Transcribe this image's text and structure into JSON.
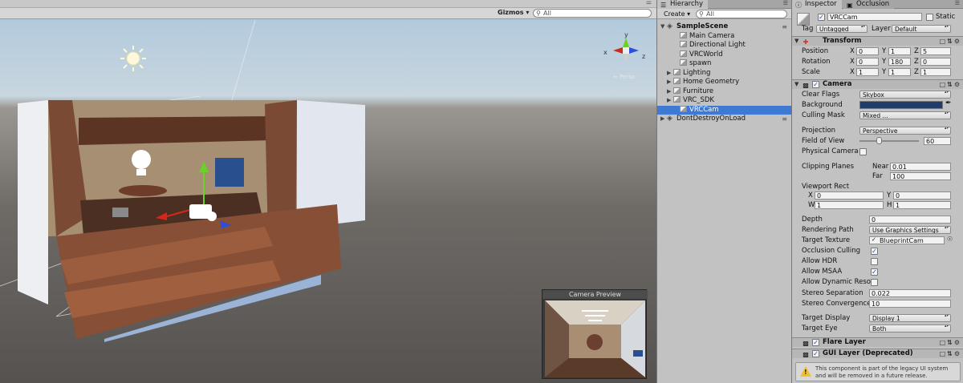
{
  "scene": {
    "gizmos_label": "Gizmos",
    "search_placeholder": "All",
    "persp_label": "← Persp",
    "preview_title": "Camera Preview",
    "axis_labels": {
      "y": "y",
      "x": "x",
      "z": "z"
    }
  },
  "hierarchy": {
    "tab": "Hierarchy",
    "create_label": "Create ▾",
    "search_placeholder": "All",
    "rows": [
      {
        "label": "SampleScene",
        "indent": 0,
        "arrow": "▼",
        "icon": "unity-scene-icon",
        "bold": true,
        "menu": true
      },
      {
        "label": "Main Camera",
        "indent": 2,
        "arrow": "",
        "icon": "gameobject-icon"
      },
      {
        "label": "Directional Light",
        "indent": 2,
        "arrow": "",
        "icon": "gameobject-icon"
      },
      {
        "label": "VRCWorld",
        "indent": 2,
        "arrow": "",
        "icon": "gameobject-icon"
      },
      {
        "label": "spawn",
        "indent": 2,
        "arrow": "",
        "icon": "gameobject-icon"
      },
      {
        "label": "Lighting",
        "indent": 1,
        "arrow": "▶",
        "icon": "gameobject-icon"
      },
      {
        "label": "Home Geometry",
        "indent": 1,
        "arrow": "▶",
        "icon": "gameobject-icon"
      },
      {
        "label": "Furniture",
        "indent": 1,
        "arrow": "▶",
        "icon": "gameobject-icon"
      },
      {
        "label": "VRC_SDK",
        "indent": 1,
        "arrow": "▶",
        "icon": "gameobject-icon"
      },
      {
        "label": "VRCCam",
        "indent": 2,
        "arrow": "",
        "icon": "gameobject-icon",
        "selected": true
      },
      {
        "label": "DontDestroyOnLoad",
        "indent": 0,
        "arrow": "▶",
        "icon": "unity-scene-icon",
        "menu": true
      }
    ]
  },
  "inspector": {
    "tabs": {
      "inspector": "Inspector",
      "occlusion": "Occlusion"
    },
    "object_name": "VRCCam",
    "static_label": "Static",
    "tag_label": "Tag",
    "tag_value": "Untagged",
    "layer_label": "Layer",
    "layer_value": "Default",
    "transform": {
      "title": "Transform",
      "position_label": "Position",
      "rotation_label": "Rotation",
      "scale_label": "Scale",
      "position": {
        "x": "0",
        "y": "1",
        "z": "5"
      },
      "rotation": {
        "x": "0",
        "y": "180",
        "z": "0"
      },
      "scale": {
        "x": "1",
        "y": "1",
        "z": "1"
      },
      "axis": {
        "x": "X",
        "y": "Y",
        "z": "Z"
      }
    },
    "camera": {
      "title": "Camera",
      "clear_flags_label": "Clear Flags",
      "clear_flags": "Skybox",
      "background_label": "Background",
      "background_color": "#1f3c6a",
      "culling_mask_label": "Culling Mask",
      "culling_mask": "Mixed ...",
      "projection_label": "Projection",
      "projection": "Perspective",
      "fov_label": "Field of View",
      "fov": "60",
      "fov_fraction": 0.33,
      "physical_label": "Physical Camera",
      "clipping_label": "Clipping Planes",
      "near_label": "Near",
      "near": "0.01",
      "far_label": "Far",
      "far": "100",
      "viewport_label": "Viewport Rect",
      "vp": {
        "x_label": "X",
        "x": "0",
        "y_label": "Y",
        "y": "0",
        "w_label": "W",
        "w": "1",
        "h_label": "H",
        "h": "1"
      },
      "depth_label": "Depth",
      "depth": "0",
      "rendering_path_label": "Rendering Path",
      "rendering_path": "Use Graphics Settings",
      "target_texture_label": "Target Texture",
      "target_texture": "BlueprintCam",
      "occlusion_label": "Occlusion Culling",
      "hdr_label": "Allow HDR",
      "msaa_label": "Allow MSAA",
      "dynres_label": "Allow Dynamic Reso",
      "stereo_sep_label": "Stereo Separation",
      "stereo_sep": "0.022",
      "stereo_conv_label": "Stereo Convergence",
      "stereo_conv": "10",
      "target_display_label": "Target Display",
      "target_display": "Display 1",
      "target_eye_label": "Target Eye",
      "target_eye": "Both"
    },
    "flare_title": "Flare Layer",
    "gui_title": "GUI Layer (Deprecated)",
    "gui_help": "This component is part of the legacy UI system and will be removed in a future release."
  }
}
